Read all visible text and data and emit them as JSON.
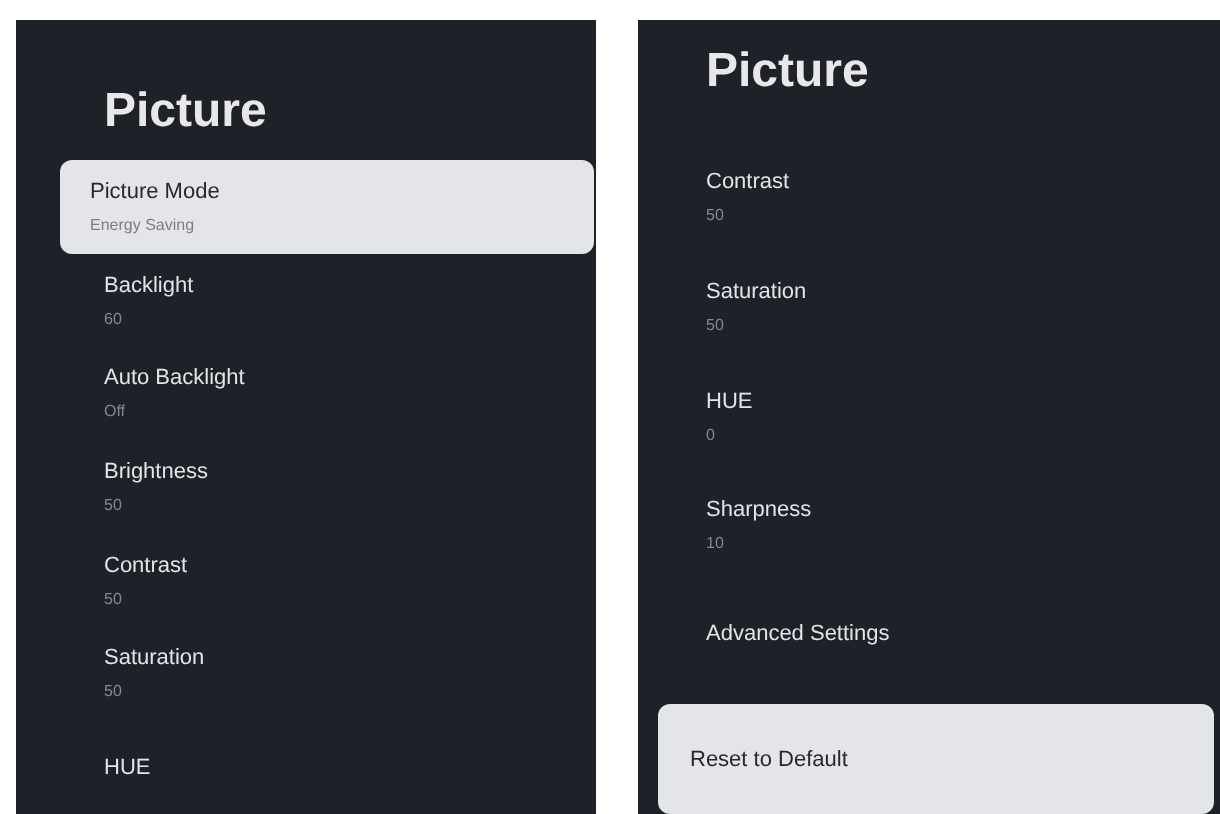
{
  "panels": [
    {
      "title": "Picture",
      "items": [
        {
          "label": "Picture Mode",
          "value": "Energy Saving",
          "selected": true
        },
        {
          "label": "Backlight",
          "value": "60",
          "selected": false
        },
        {
          "label": "Auto Backlight",
          "value": "Off",
          "selected": false
        },
        {
          "label": "Brightness",
          "value": "50",
          "selected": false
        },
        {
          "label": "Contrast",
          "value": "50",
          "selected": false
        },
        {
          "label": "Saturation",
          "value": "50",
          "selected": false
        },
        {
          "label": "HUE",
          "selected": false
        }
      ]
    },
    {
      "title": "Picture",
      "items": [
        {
          "label": "Contrast",
          "value": "50",
          "selected": false
        },
        {
          "label": "Saturation",
          "value": "50",
          "selected": false
        },
        {
          "label": "HUE",
          "value": "0",
          "selected": false
        },
        {
          "label": "Sharpness",
          "value": "10",
          "selected": false
        },
        {
          "label": "Advanced Settings",
          "selected": false
        },
        {
          "label": "Reset to Default",
          "selected": true
        }
      ]
    }
  ]
}
